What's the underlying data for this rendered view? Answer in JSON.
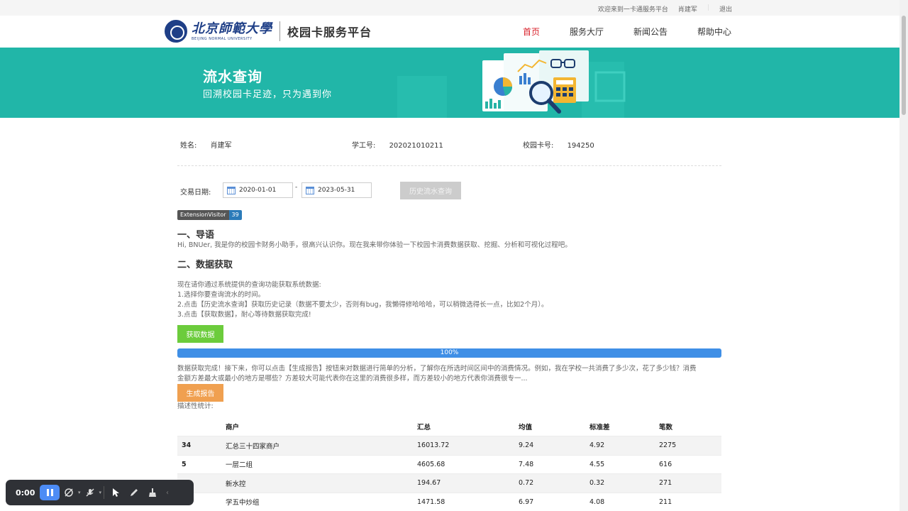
{
  "topbar": {
    "welcome": "欢迎来到一卡通服务平台",
    "user": "肖建军",
    "logout": "退出"
  },
  "header": {
    "logo_cn": "北京師範大學",
    "logo_en": "BEIJING NORMAL UNIVERSITY",
    "platform": "校园卡服务平台",
    "nav": [
      {
        "label": "首页",
        "active": true
      },
      {
        "label": "服务大厅",
        "active": false
      },
      {
        "label": "新闻公告",
        "active": false
      },
      {
        "label": "帮助中心",
        "active": false
      }
    ]
  },
  "banner": {
    "title": "流水查询",
    "subtitle": "回溯校园卡足迹，只为遇到你"
  },
  "info": {
    "name_label": "姓名:",
    "name": "肖建军",
    "id_label": "学工号:",
    "id": "202021010211",
    "card_label": "校园卡号:",
    "card": "194250"
  },
  "query": {
    "date_label": "交易日期:",
    "start": "2020-01-01",
    "sep": "-",
    "end": "2023-05-31",
    "history_btn": "历史流水查询"
  },
  "badge": {
    "left": "ExtensionVisitor",
    "right": "39"
  },
  "sections": {
    "intro_title": "一、导语",
    "intro_text": "Hi, BNUer, 我是你的校园卡财务小助手，很高兴认识你。现在我来带你体验一下校园卡消费数据获取、挖掘、分析和可视化过程吧。",
    "fetch_title": "二、数据获取",
    "fetch_lines": [
      "现在请你通过系统提供的查询功能获取系统数据:",
      "1.选择你要查询流水的时间。",
      "2.点击【历史流水查询】获取历史记录（数据不要太少，否则有bug，我懒得修哈哈哈，可以稍微选得长一点，比如2个月）。",
      "3.点击【获取数据】，耐心等待数据获取完成!"
    ],
    "fetch_btn": "获取数据",
    "progress_text": "100%",
    "progress_value": 100,
    "done_line1": "数据获取完成！接下来，你可以点击【生成报告】按钮来对数据进行简单的分析，了解你在所选时间区间中的消费情况。例如，我在学校一共消费了多少次，花了多少钱？消费",
    "done_line2": "金额方差最大或最小的地方是哪些？方差较大可能代表你在这里的消费很多样，而方差较小的地方代表你消费很专一...",
    "report_btn": "生成报告",
    "stats_label": "描述性统计:"
  },
  "table": {
    "headers": [
      "",
      "商户",
      "汇总",
      "均值",
      "标准差",
      "笔数"
    ],
    "rows": [
      [
        "34",
        "汇总三十四家商户",
        "16013.72",
        "9.24",
        "4.92",
        "2275"
      ],
      [
        "5",
        "一层二组",
        "4605.68",
        "7.48",
        "4.55",
        "616"
      ],
      [
        "",
        "新水控",
        "194.67",
        "0.72",
        "0.32",
        "271"
      ],
      [
        "",
        "学五中炒组",
        "1471.58",
        "6.97",
        "4.08",
        "211"
      ]
    ]
  },
  "recorder": {
    "time": "0:00"
  },
  "colors": {
    "banner": "#21b6a8",
    "nav_active": "#d9232c",
    "progress": "#3f8fe6",
    "green_btn": "#6ccc3c",
    "orange_btn": "#f0a050"
  }
}
